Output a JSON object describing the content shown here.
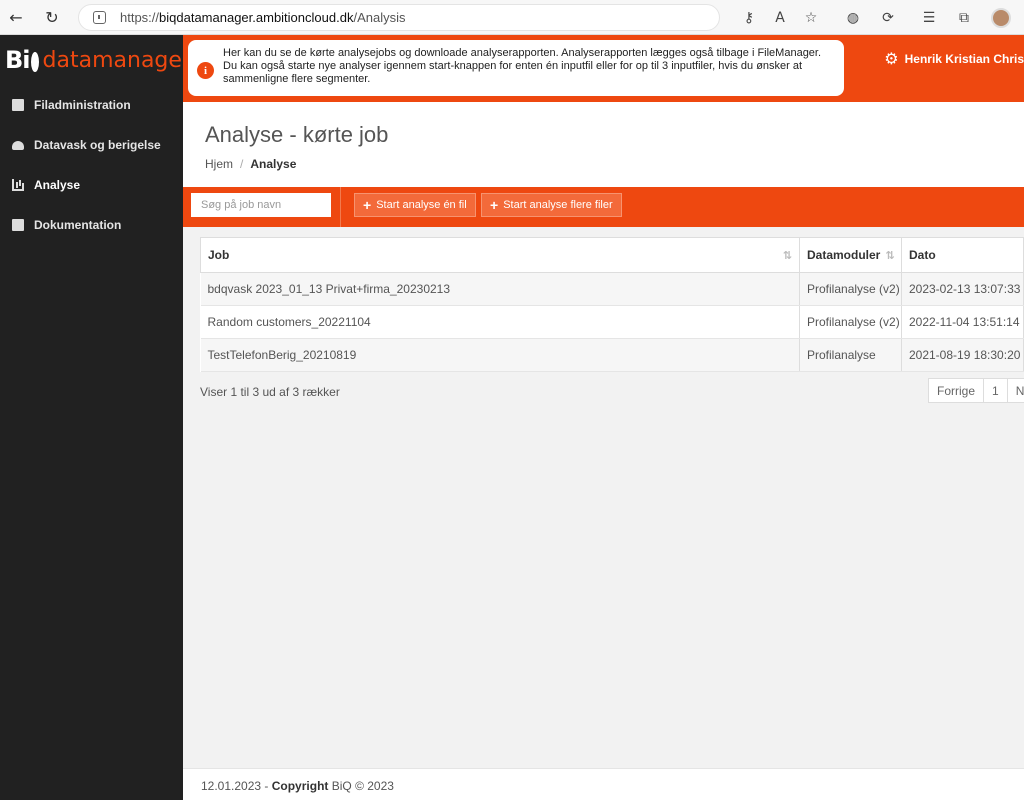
{
  "browser": {
    "url_scheme": "https://",
    "url_host": "biqdatamanager.ambitioncloud.dk",
    "url_path": "/Analysis"
  },
  "sidebar": {
    "logo_biq": "Bi",
    "logo_dm": "datamanager",
    "items": [
      {
        "label": "Filadministration",
        "icon": "files-icon"
      },
      {
        "label": "Datavask og berigelse",
        "icon": "cloud-upload-icon"
      },
      {
        "label": "Analyse",
        "icon": "chart-icon"
      },
      {
        "label": "Dokumentation",
        "icon": "book-icon"
      }
    ]
  },
  "header": {
    "info_text": "Her kan du se de kørte analysejobs og downloade analyserapporten. Analyserapporten lægges også tilbage i FileManager. Du kan også starte nye analyser igennem start-knappen for enten én inputfil eller for op til 3 inputfiler, hvis du ønsker at sammenligne flere segmenter.",
    "user_name": "Henrik Kristian Chris"
  },
  "page": {
    "title": "Analyse - kørte job",
    "breadcrumb_home": "Hjem",
    "breadcrumb_sep": "/",
    "breadcrumb_current": "Analyse"
  },
  "actions": {
    "search_placeholder": "Søg på job navn",
    "start_one": "Start analyse én fil",
    "start_many": "Start analyse flere filer"
  },
  "table": {
    "headers": {
      "job": "Job",
      "modules": "Datamoduler",
      "date": "Dato"
    },
    "rows": [
      {
        "job": "bdqvask 2023_01_13 Privat+firma_20230213",
        "modules": "Profilanalyse (v2)",
        "date": "2023-02-13 13:07:33"
      },
      {
        "job": "Random customers_20221104",
        "modules": "Profilanalyse (v2)",
        "date": "2022-11-04 13:51:14"
      },
      {
        "job": "TestTelefonBerig_20210819",
        "modules": "Profilanalyse",
        "date": "2021-08-19 18:30:20"
      }
    ],
    "info": "Viser 1 til 3 ud af 3 rækker",
    "pager_prev": "Forrige",
    "pager_page": "1",
    "pager_next": "N"
  },
  "footer": {
    "date": "12.01.2023 - ",
    "copyright_label": "Copyright",
    "copyright_rest": " BiQ © 2023"
  },
  "colors": {
    "brand_orange": "#ee4810",
    "sidebar_bg": "#212121"
  }
}
